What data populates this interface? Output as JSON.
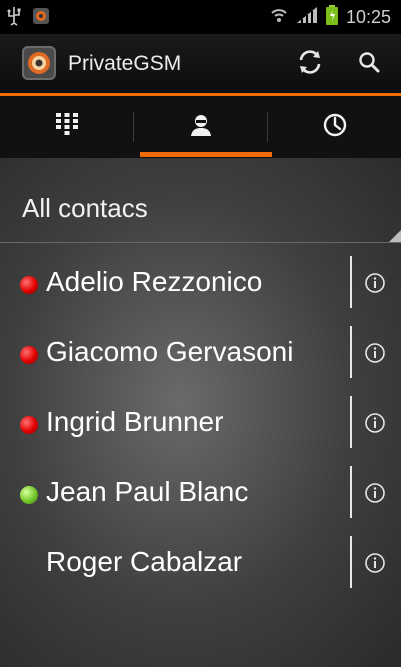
{
  "status_bar": {
    "time": "10:25",
    "left_icons": [
      "usb-icon",
      "app-notification-icon"
    ],
    "right_icons": [
      "wifi-icon",
      "signal-icon",
      "battery-icon"
    ]
  },
  "action_bar": {
    "title": "PrivateGSM",
    "accent_color": "#f06c00",
    "actions": [
      "sync-icon",
      "search-icon"
    ]
  },
  "tabs": [
    {
      "icon": "dialpad-icon",
      "selected": false
    },
    {
      "icon": "contacts-icon",
      "selected": true
    },
    {
      "icon": "clock-icon",
      "selected": false
    }
  ],
  "contacts_filter": {
    "label": "All contacs"
  },
  "contacts": [
    {
      "name": "Adelio Rezzonico",
      "status": "red"
    },
    {
      "name": "Giacomo Gervasoni",
      "status": "red"
    },
    {
      "name": "Ingrid Brunner",
      "status": "red"
    },
    {
      "name": "Jean Paul Blanc",
      "status": "green"
    },
    {
      "name": "Roger Cabalzar",
      "status": "none"
    }
  ]
}
